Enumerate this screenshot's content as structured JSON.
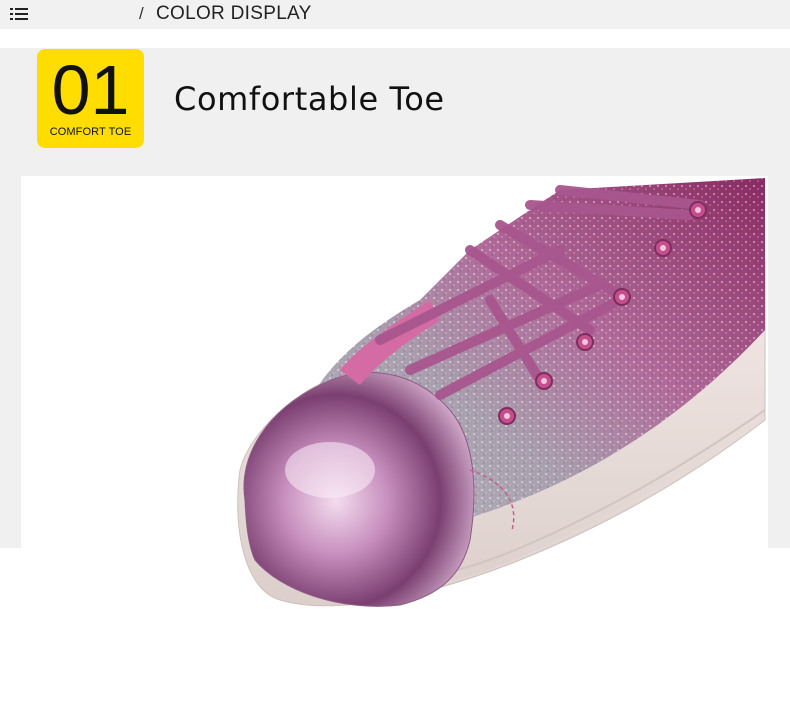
{
  "header": {
    "menu_icon": "list-icon",
    "separator": "/",
    "title": "COLOR DISPLAY"
  },
  "feature": {
    "number": "01",
    "caption": "COMFORT TOE",
    "heading": "Comfortable Toe",
    "badge_color": "#ffdd00"
  },
  "product_image": {
    "subject": "pink glitter sneaker with metallic toe cap"
  }
}
